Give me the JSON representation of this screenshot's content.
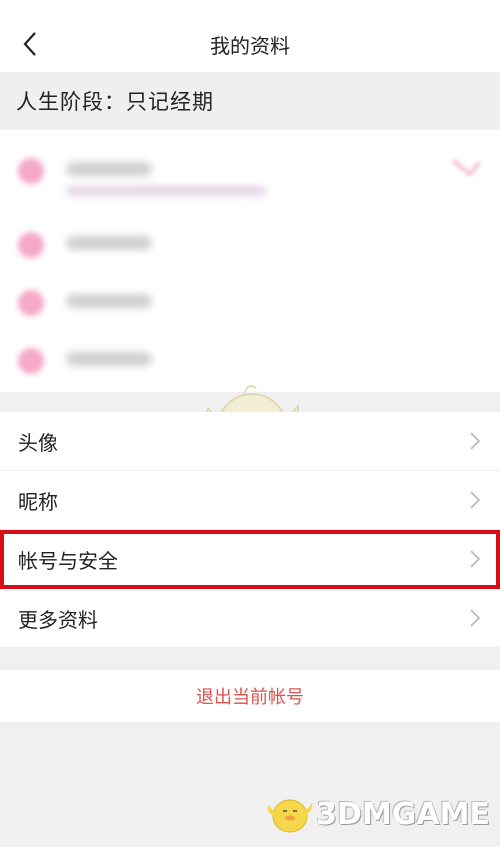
{
  "nav": {
    "back_icon": "chevron-left-icon",
    "title": "我的资料"
  },
  "stage": {
    "label": "人生阶段：只记经期"
  },
  "menu": {
    "items": [
      {
        "label": "头像"
      },
      {
        "label": "昵称"
      },
      {
        "label": "帐号与安全"
      },
      {
        "label": "更多资料"
      }
    ]
  },
  "logout": {
    "label": "退出当前帐号"
  },
  "watermark": {
    "text": "3DMGAME"
  },
  "colors": {
    "highlight": "#d40f17",
    "logout_text": "#d9534f",
    "accent_pink": "#f4a9c6"
  }
}
